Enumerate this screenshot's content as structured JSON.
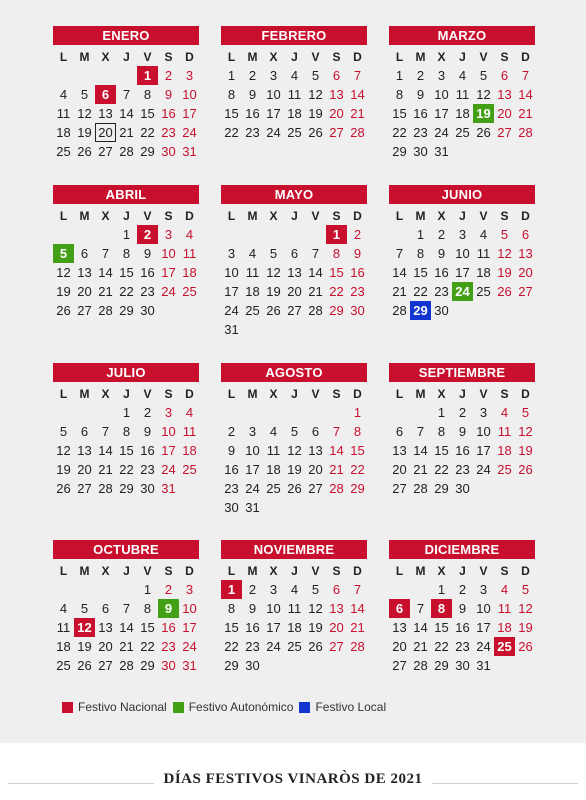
{
  "weekday_headers": [
    "L",
    "M",
    "X",
    "J",
    "V",
    "S",
    "D"
  ],
  "months": [
    {
      "name": "ENERO",
      "offset": 4,
      "days": 31,
      "nacional": [
        1,
        6
      ],
      "autonomico": [],
      "local": [],
      "outlined": [
        20
      ]
    },
    {
      "name": "FEBRERO",
      "offset": 0,
      "days": 28,
      "nacional": [],
      "autonomico": [],
      "local": [],
      "outlined": []
    },
    {
      "name": "MARZO",
      "offset": 0,
      "days": 31,
      "nacional": [],
      "autonomico": [
        19
      ],
      "local": [],
      "outlined": []
    },
    {
      "name": "ABRIL",
      "offset": 3,
      "days": 30,
      "nacional": [
        2
      ],
      "autonomico": [
        5
      ],
      "local": [],
      "outlined": []
    },
    {
      "name": "MAYO",
      "offset": 5,
      "days": 31,
      "nacional": [
        1
      ],
      "autonomico": [],
      "local": [],
      "outlined": []
    },
    {
      "name": "JUNIO",
      "offset": 1,
      "days": 30,
      "nacional": [],
      "autonomico": [
        24
      ],
      "local": [
        29
      ],
      "outlined": []
    },
    {
      "name": "JULIO",
      "offset": 3,
      "days": 31,
      "nacional": [],
      "autonomico": [],
      "local": [],
      "outlined": []
    },
    {
      "name": "AGOSTO",
      "offset": 6,
      "days": 31,
      "nacional": [],
      "autonomico": [],
      "local": [],
      "outlined": []
    },
    {
      "name": "SEPTIEMBRE",
      "offset": 2,
      "days": 30,
      "nacional": [],
      "autonomico": [],
      "local": [],
      "outlined": []
    },
    {
      "name": "OCTUBRE",
      "offset": 4,
      "days": 31,
      "nacional": [
        12
      ],
      "autonomico": [
        9
      ],
      "local": [],
      "outlined": []
    },
    {
      "name": "NOVIEMBRE",
      "offset": 0,
      "days": 30,
      "nacional": [
        1
      ],
      "autonomico": [],
      "local": [],
      "outlined": []
    },
    {
      "name": "DICIEMBRE",
      "offset": 2,
      "days": 31,
      "nacional": [
        6,
        8,
        25
      ],
      "autonomico": [],
      "local": [],
      "outlined": []
    }
  ],
  "legend": {
    "nacional": {
      "label": "Festivo Nacional",
      "color": "#c8102e"
    },
    "autonomico": {
      "label": "Festivo Autonómico",
      "color": "#43a016"
    },
    "local": {
      "label": "Festivo Local",
      "color": "#1234d1"
    }
  },
  "title": "DÍAS FESTIVOS VINARÒS DE 2021"
}
